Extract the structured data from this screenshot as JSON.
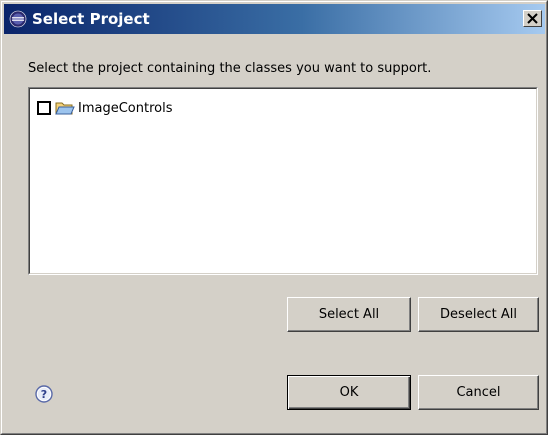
{
  "window": {
    "title": "Select Project",
    "close_symbol": "×",
    "icon": "eclipse-app-icon"
  },
  "instruction": "Select the project containing the classes you want to support.",
  "tree": {
    "items": [
      {
        "label": "ImageControls",
        "checked": false,
        "icon": "folder-open-icon"
      }
    ]
  },
  "buttons": {
    "select_all": "Select All",
    "deselect_all": "Deselect All",
    "ok": "OK",
    "cancel": "Cancel"
  },
  "help": {
    "icon": "help-icon",
    "symbol": "?"
  },
  "colors": {
    "titlebar_start": "#0a246a",
    "titlebar_end": "#a6caf0",
    "dialog_face": "#d4d0c8",
    "list_background": "#ffffff"
  }
}
